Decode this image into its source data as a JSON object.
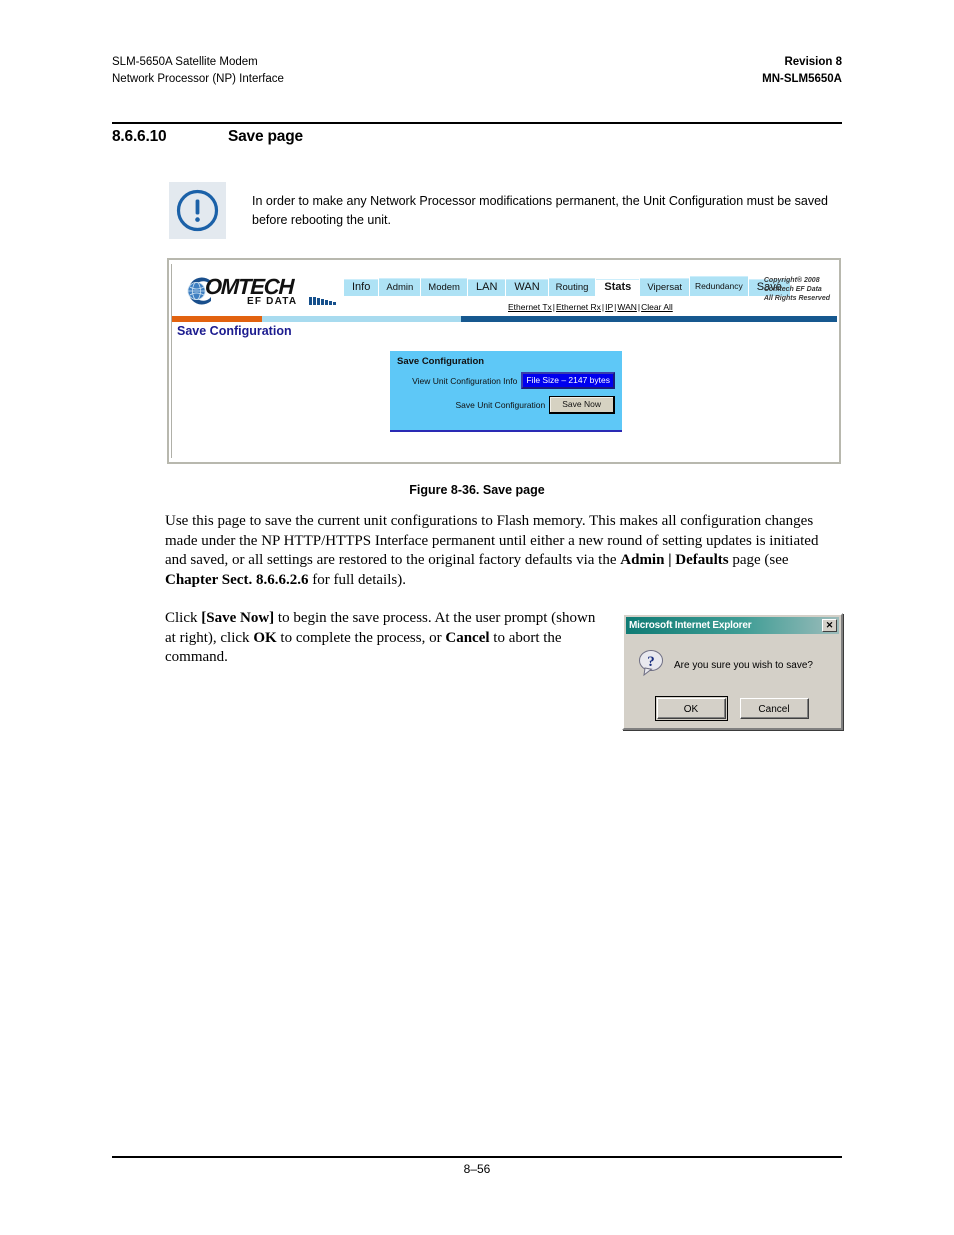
{
  "header": {
    "left_line1": "SLM-5650A Satellite Modem",
    "left_line2": "Network Processor (NP) Interface",
    "right_line1": "Revision 8",
    "right_line2": "MN-SLM5650A"
  },
  "section": {
    "number": "8.6.6.10",
    "title": "Save page"
  },
  "note": {
    "icon": "exclamation-circle-icon",
    "text": "In order to make any Network Processor modifications permanent, the Unit Configuration must be saved before rebooting the unit."
  },
  "figure": {
    "caption": "Figure 8-36. Save page",
    "browser": {
      "logo": {
        "word_main": "OMTECH",
        "word_sub": "EF DATA"
      },
      "copyright": [
        "Copyright® 2008",
        "Comtech EF Data",
        "All Rights Reserved"
      ],
      "tabs": [
        {
          "label": "Info",
          "active": false
        },
        {
          "label": "Admin",
          "active": false
        },
        {
          "label": "Modem",
          "active": false
        },
        {
          "label": "LAN",
          "active": false
        },
        {
          "label": "WAN",
          "active": false
        },
        {
          "label": "Routing",
          "active": false
        },
        {
          "label": "Stats",
          "active": true
        },
        {
          "label": "Vipersat",
          "active": false
        },
        {
          "label": "Redundancy",
          "active": false
        },
        {
          "label": "Save",
          "active": false
        }
      ],
      "subnav": [
        "Ethernet Tx",
        "Ethernet Rx",
        "IP",
        "WAN",
        "Clear All"
      ],
      "subnav_separator": "|",
      "page_title": "Save Configuration",
      "panel": {
        "title": "Save Configuration",
        "row1_label": "View Unit Configuration Info",
        "row1_value": "File Size – 2147 bytes",
        "row2_label": "Save Unit Configuration",
        "row2_button": "Save Now"
      },
      "colors": {
        "stripe_orange": "#e2620f",
        "stripe_light_blue": "#a8dbef",
        "stripe_dark_blue": "#16588f",
        "tab_blue": "#aee2f5",
        "panel_blue": "#5ec8f7",
        "value_blue": "#0000ee",
        "title_navy": "#1b1b8f"
      }
    }
  },
  "body": {
    "para1": {
      "t1": "Use this page to save the current unit configurations to Flash memory. This makes all configuration changes made under the NP HTTP/HTTPS Interface permanent until either a new round of setting updates is initiated and saved, or all settings are restored to the original factory defaults via the ",
      "b1": "Admin | Defaults",
      "t2": " page (see ",
      "b2": "Chapter Sect. 8.6.6.2.6",
      "t3": " for full details)."
    },
    "para2": {
      "t1": "Click ",
      "b1": "[Save Now]",
      "t2": " to begin the save process. At the user prompt (shown at right), click ",
      "b2": "OK",
      "t3": " to complete the process, or ",
      "b3": "Cancel",
      "t4": " to abort the command."
    }
  },
  "dialog": {
    "title": "Microsoft Internet Explorer",
    "close_label": "✕",
    "icon": "question-mark-bubble-icon",
    "message": "Are you sure you wish to save?",
    "ok_label": "OK",
    "cancel_label": "Cancel"
  },
  "footer": {
    "page_number": "8–56"
  }
}
